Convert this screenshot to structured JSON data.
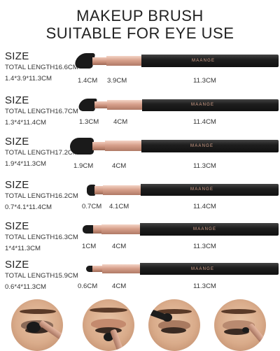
{
  "header": {
    "line1": "MAKEUP BRUSH",
    "line2": "SUITABLE FOR EYE USE"
  },
  "brushes": [
    {
      "size_label": "SIZE",
      "total": "TOTAL LENGTH16.6CM",
      "spec": "1.4*3.9*11.3CM",
      "bristle": "1.4CM",
      "ferrule": "3.9CM",
      "handle": "11.3CM",
      "brand": "MAANGE",
      "shape": "angled-large"
    },
    {
      "size_label": "SIZE",
      "total": "TOTAL LENGTH16.7CM",
      "spec": "1.3*4*11.4CM",
      "bristle": "1.3CM",
      "ferrule": "4CM",
      "handle": "11.4CM",
      "brand": "MAANGE",
      "shape": "angled"
    },
    {
      "size_label": "SIZE",
      "total": "TOTAL LENGTH17.2CM",
      "spec": "1.9*4*11.3CM",
      "bristle": "1.9CM",
      "ferrule": "4CM",
      "handle": "11.3CM",
      "brand": "MAANGE",
      "shape": "fluffy"
    },
    {
      "size_label": "SIZE",
      "total": "TOTAL LENGTH16.2CM",
      "spec": "0.7*4.1*11.4CM",
      "bristle": "0.7CM",
      "ferrule": "4.1CM",
      "handle": "11.4CM",
      "brand": "MAANGE",
      "shape": "flat"
    },
    {
      "size_label": "SIZE",
      "total": "TOTAL LENGTH16.3CM",
      "spec": "1*4*11.3CM",
      "bristle": "1CM",
      "ferrule": "4CM",
      "handle": "11.3CM",
      "brand": "MAANGE",
      "shape": "flat-small"
    },
    {
      "size_label": "SIZE",
      "total": "TOTAL LENGTH15.9CM",
      "spec": "0.6*4*11.3CM",
      "bristle": "0.6CM",
      "ferrule": "4CM",
      "handle": "11.3CM",
      "brand": "MAANGE",
      "shape": "pencil"
    }
  ],
  "colors": {
    "bristle": "#1a1a1a",
    "ferrule": "#d7a08b",
    "handle": "#1e1e1e",
    "brand_text": "#d9a48d"
  },
  "photos": [
    {
      "icon": "eye-application-photo-1"
    },
    {
      "icon": "eye-application-photo-2"
    },
    {
      "icon": "eye-application-photo-3"
    },
    {
      "icon": "eye-application-photo-4"
    }
  ]
}
